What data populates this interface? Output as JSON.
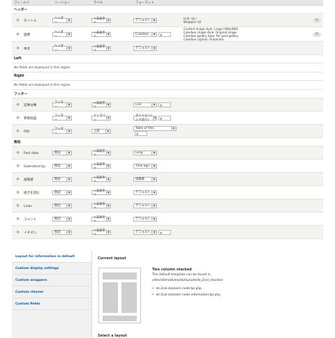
{
  "table": {
    "headers": [
      "フィールド",
      "リージョン",
      "ラベル",
      "フォーマット"
    ],
    "regions": [
      {
        "name": "ヘッダー",
        "empty_text": "",
        "rows": [
          {
            "name": "タイトル",
            "region": "ヘッダー",
            "label": "<非表示>",
            "format": "デフォルト",
            "extra": "",
            "summary": [
              "Link: はい",
              "Wrapper: h2"
            ],
            "gear": true
          },
          {
            "name": "画像",
            "region": "ヘッダー",
            "label": "<非表示>",
            "format": "Colorbox",
            "extra": "#",
            "summary": [
              "Content image style: Large (480x480)",
              "Colorbox image style: Original image",
              "Colorbox gallery type: Per post gallery",
              "Colorbox caption: Automatic"
            ],
            "gear": true
          },
          {
            "name": "本文",
            "region": "ヘッダー",
            "label": "<非表示>",
            "format": "デフォルト",
            "extra": "",
            "summary": [],
            "gear": false
          }
        ]
      },
      {
        "name": "Left",
        "empty_text": "No fields are displayed in this region",
        "rows": []
      },
      {
        "name": "Right",
        "empty_text": "No fields are displayed in this region",
        "rows": []
      },
      {
        "name": "フッター",
        "empty_text": "",
        "rows": [
          {
            "name": "記事分類",
            "region": "フッター",
            "label": "<非表示>",
            "format": "Link",
            "extra": "#",
            "summary": [],
            "gear": false
          },
          {
            "name": "参照商品",
            "region": "フッター",
            "label": "インライン",
            "format": "タイトル (リンクあり)",
            "extra": "#",
            "summary": [],
            "gear": false
          },
          {
            "name": "PDF",
            "region": "フッター",
            "label": "上部",
            "format": "Table of files",
            "extra": "#",
            "summary": [],
            "gear": false
          }
        ]
      },
      {
        "name": "無効",
        "empty_text": "",
        "rows": [
          {
            "name": "Post date",
            "region": "無効",
            "label": "<非表示>",
            "format": "Long",
            "extra": "",
            "summary": [],
            "gear": false
          },
          {
            "name": "Submitted by",
            "region": "無効",
            "label": "<非表示>",
            "format": "Time ago",
            "extra": "",
            "summary": [],
            "gear": false
          },
          {
            "name": "投稿者",
            "region": "無効",
            "label": "<非表示>",
            "format": "投稿者",
            "extra": "",
            "summary": [],
            "gear": false
          },
          {
            "name": "続きを読む",
            "region": "無効",
            "label": "<非表示>",
            "format": "デフォルト",
            "extra": "",
            "summary": [],
            "gear": false
          },
          {
            "name": "Links",
            "region": "無効",
            "label": "<非表示>",
            "format": "デフォルト",
            "extra": "",
            "summary": [],
            "gear": false
          },
          {
            "name": "コメント",
            "region": "無効",
            "label": "<非表示>",
            "format": "デフォルト",
            "extra": "",
            "summary": [],
            "gear": false
          },
          {
            "name": "イチオシ",
            "region": "無効",
            "label": "<非表示>",
            "format": "デフォルト",
            "extra": "#",
            "summary": [],
            "gear": false
          }
        ]
      }
    ]
  },
  "tabs": [
    "Layout for information in default",
    "Custom display settings",
    "Custom wrappers",
    "Custom classes",
    "Custom fields"
  ],
  "active_tab": 0,
  "layout": {
    "current_heading": "Current layout",
    "name": "Two column stacked",
    "description": "The default template can be found in",
    "path": "sites/all/modules/ds/layouts/ds_2col_stacked",
    "templates": [
      "ds-2col-stacked--node.tpl.php",
      "ds-2col-stacked--node-information.tpl.php"
    ],
    "select_heading": "Select a layout"
  },
  "icons": {
    "drag": "drag-cross-icon",
    "settings": "gear-icon",
    "dropdown": "chevron-down-icon"
  }
}
